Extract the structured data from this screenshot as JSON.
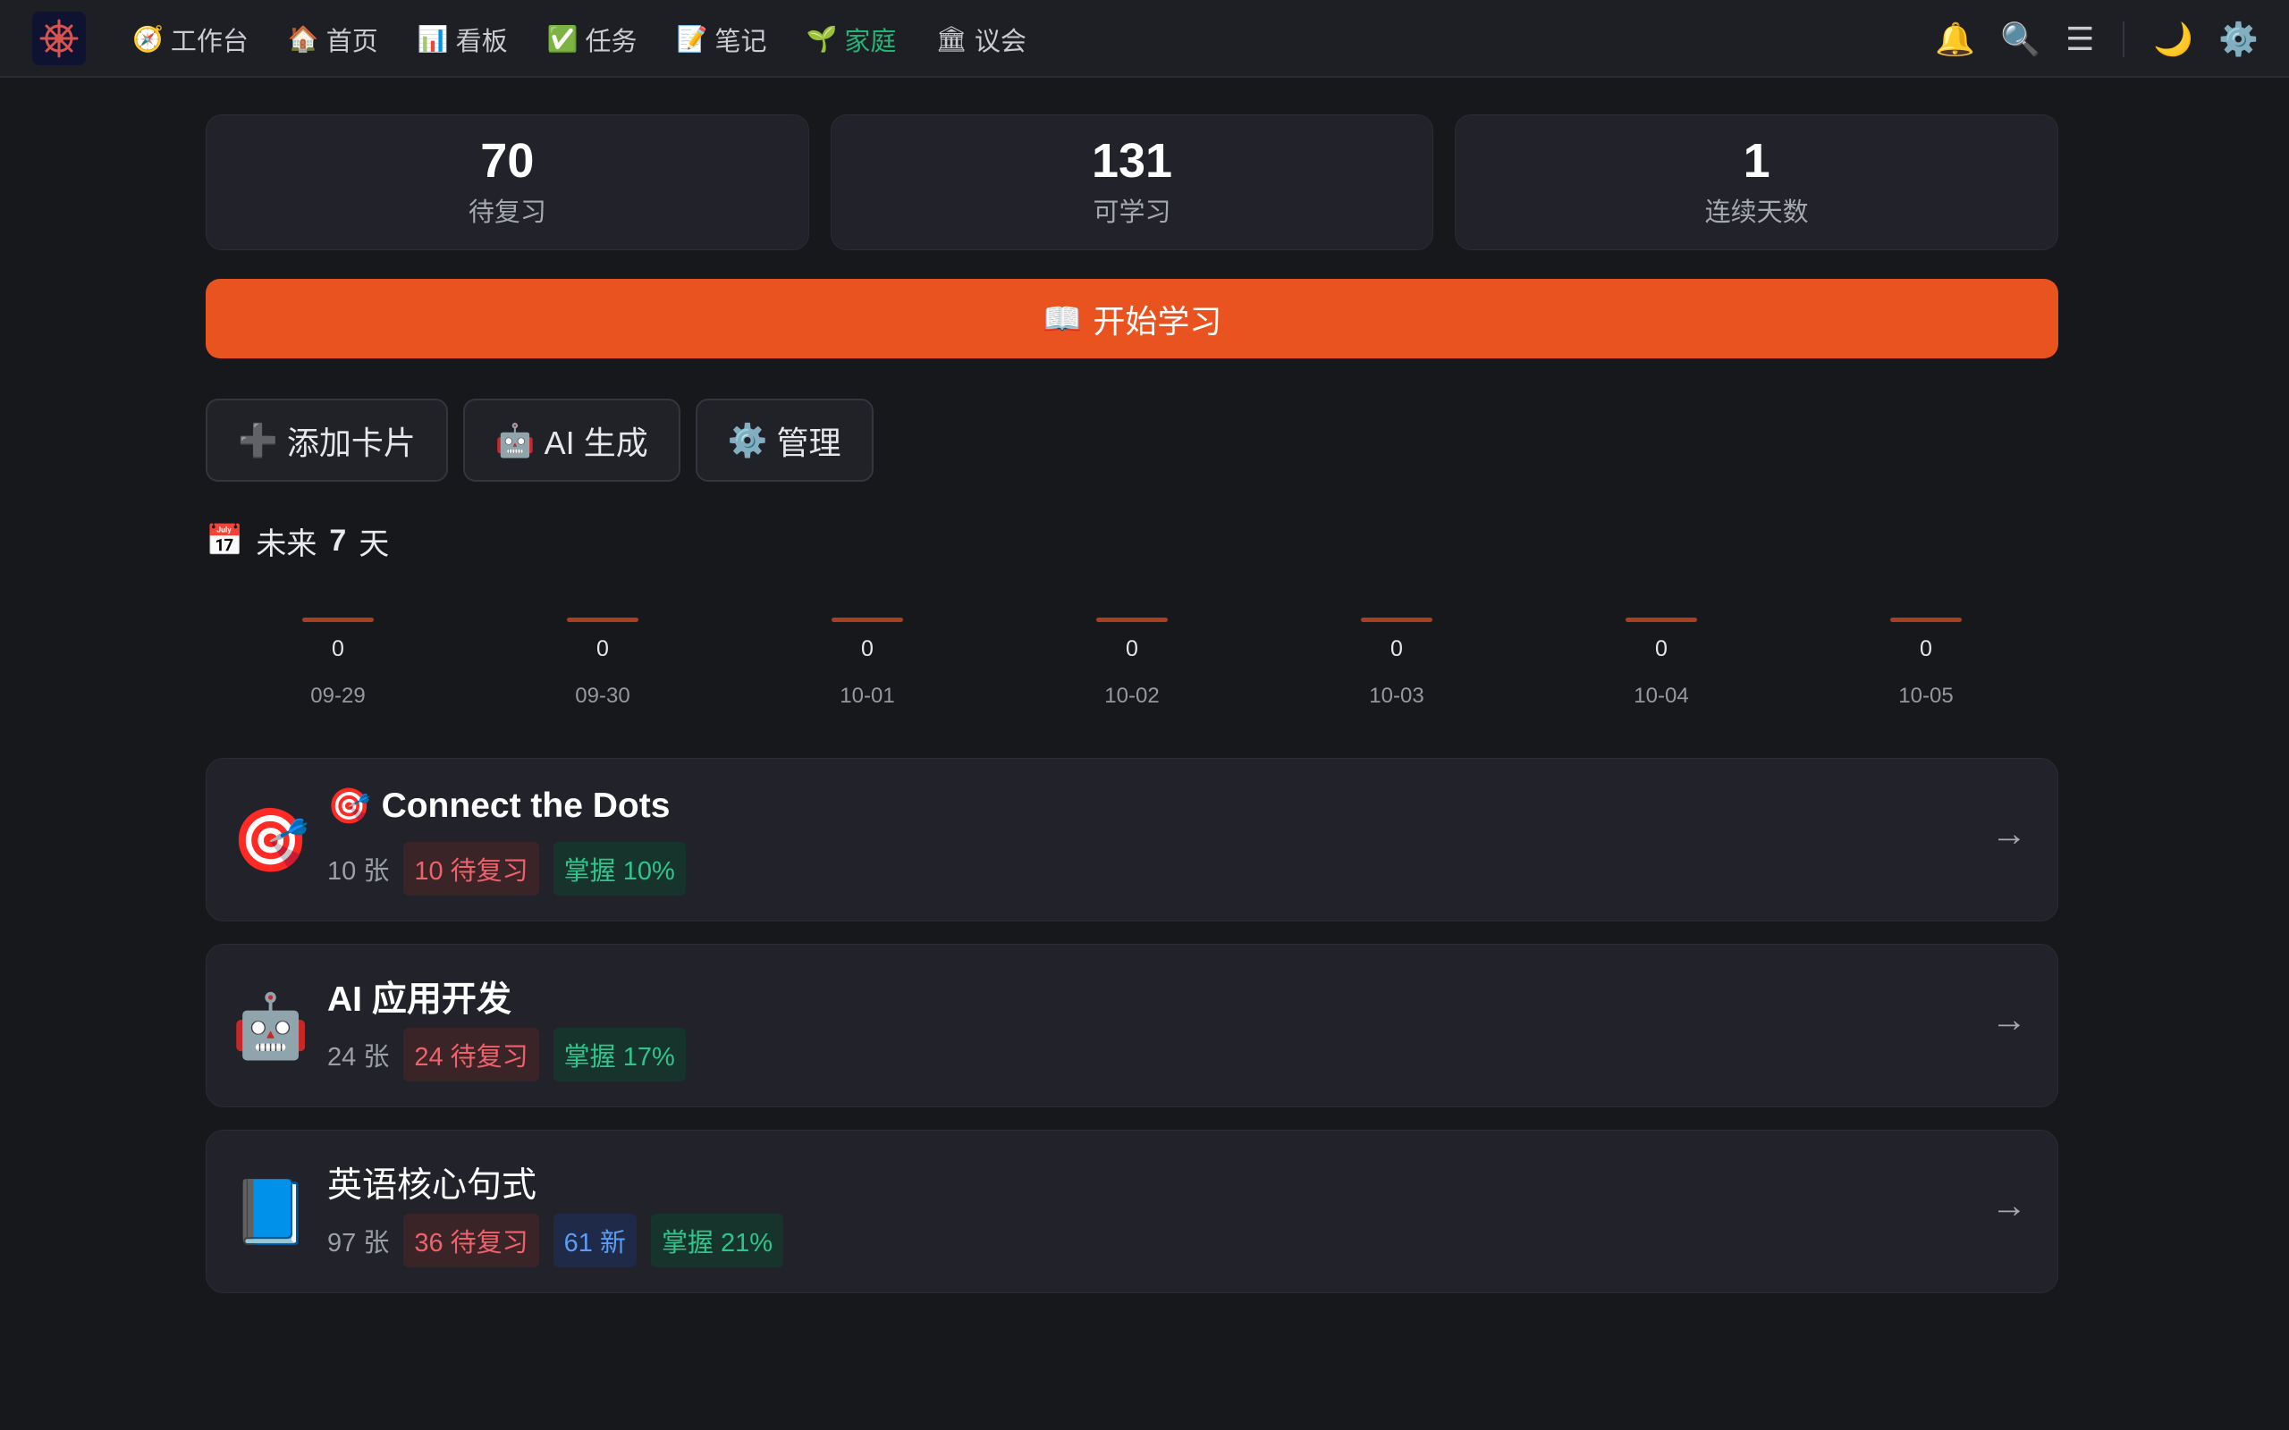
{
  "nav": {
    "items": [
      {
        "icon": "🧭",
        "label": "工作台",
        "active": false
      },
      {
        "icon": "🏠",
        "label": "首页",
        "active": false
      },
      {
        "icon": "📊",
        "label": "看板",
        "active": false
      },
      {
        "icon": "✅",
        "label": "任务",
        "active": false
      },
      {
        "icon": "📝",
        "label": "笔记",
        "active": false
      },
      {
        "icon": "🌱",
        "label": "家庭",
        "active": true
      },
      {
        "icon": "🏛",
        "label": "议会",
        "active": false
      }
    ],
    "right_icons": {
      "bell": "🔔",
      "search": "🔍",
      "menu": "☰",
      "theme": "🌙",
      "settings": "⚙️"
    }
  },
  "stats": [
    {
      "value": "70",
      "label": "待复习"
    },
    {
      "value": "131",
      "label": "可学习"
    },
    {
      "value": "1",
      "label": "连续天数"
    }
  ],
  "start_button": {
    "icon": "📖",
    "label": "开始学习"
  },
  "actions": [
    {
      "icon": "➕",
      "label": "添加卡片"
    },
    {
      "icon": "🤖",
      "label": "AI 生成"
    },
    {
      "icon": "⚙️",
      "label": "管理"
    }
  ],
  "forecast": {
    "icon": "📅",
    "title_prefix": "未来",
    "title_number": "7",
    "title_suffix": "天",
    "days": [
      {
        "count": "0",
        "date": "09-29"
      },
      {
        "count": "0",
        "date": "09-30"
      },
      {
        "count": "0",
        "date": "10-01"
      },
      {
        "count": "0",
        "date": "10-02"
      },
      {
        "count": "0",
        "date": "10-03"
      },
      {
        "count": "0",
        "date": "10-04"
      },
      {
        "count": "0",
        "date": "10-05"
      }
    ]
  },
  "decks": [
    {
      "icon": "🎯",
      "title_icon": "🎯",
      "title": "Connect the Dots",
      "count": "10 张",
      "due": "10 待复习",
      "new": "",
      "mastery": "掌握 10%",
      "arrow": "→"
    },
    {
      "icon": "🤖",
      "title_icon": "",
      "title": "AI 应用开发",
      "count": "24 张",
      "due": "24 待复习",
      "new": "",
      "mastery": "掌握 17%",
      "arrow": "→"
    },
    {
      "icon": "📘",
      "title_icon": "",
      "title": "英语核心句式",
      "count": "97 张",
      "due": "36 待复习",
      "new": "61 新",
      "mastery": "掌握 21%",
      "arrow": "→"
    }
  ],
  "colors": {
    "accent": "#e8531f",
    "active_nav": "#22b573",
    "due": "#f0626a",
    "new": "#5b9cf5",
    "mastery": "#2fc48a"
  }
}
